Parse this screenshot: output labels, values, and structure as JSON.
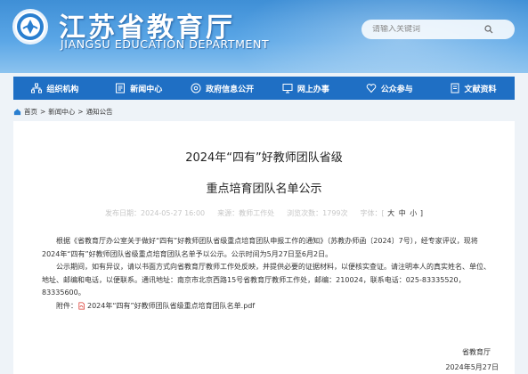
{
  "header": {
    "title_cn": "江苏省教育厅",
    "title_en": "JIANGSU EDUCATION DEPARTMENT",
    "search_placeholder": "请输入关键词"
  },
  "nav": [
    {
      "label": "组织机构",
      "icon": "org-icon"
    },
    {
      "label": "新闻中心",
      "icon": "news-icon"
    },
    {
      "label": "政府信息公开",
      "icon": "info-icon"
    },
    {
      "label": "网上办事",
      "icon": "monitor-icon"
    },
    {
      "label": "公众参与",
      "icon": "heart-icon"
    },
    {
      "label": "文献资料",
      "icon": "book-icon"
    }
  ],
  "breadcrumb": {
    "home": "首页",
    "sep": ">",
    "news": "新闻中心",
    "notices": "通知公告"
  },
  "article": {
    "title_line1": "2024年“四有”好教师团队省级",
    "title_line2": "重点培育团队名单公示",
    "meta": {
      "date": "发布日期：2024-05-27 16:00",
      "source": "来源：教师工作处",
      "views": "浏览次数：1799次",
      "font_label": "字体：[",
      "size_large": "大",
      "size_medium": "中",
      "size_small": "小",
      "font_close": "]"
    },
    "para1": "根据《省教育厅办公室关于做好“四有”好教师团队省级重点培育团队申报工作的通知》（苏教办师函〔2024〕7号），经专家评议，现将2024年“四有”好教师团队省级重点培育团队名单予以公示。公示时间为5月27日至6月2日。",
    "para2": "公示期间，如有异议，请以书面方式向省教育厅教师工作处反映，并提供必要的证据材料，以便核实查证。请注明本人的真实姓名、单位、地址、邮编和电话，以便联系。通讯地址：南京市北京西路15号省教育厅教师工作处，邮编：210024，联系电话：025-83335520，83335600。",
    "attachment_label": "附件：",
    "attachment_file": "2024年“四有”好教师团队省级重点培育团队名单.pdf",
    "signature": "省教育厅",
    "sign_date": "2024年5月27日"
  },
  "colors": {
    "header_blue": "#3f8fd6",
    "nav_blue": "#1f6fc4",
    "pdf_red": "#d9342b"
  }
}
